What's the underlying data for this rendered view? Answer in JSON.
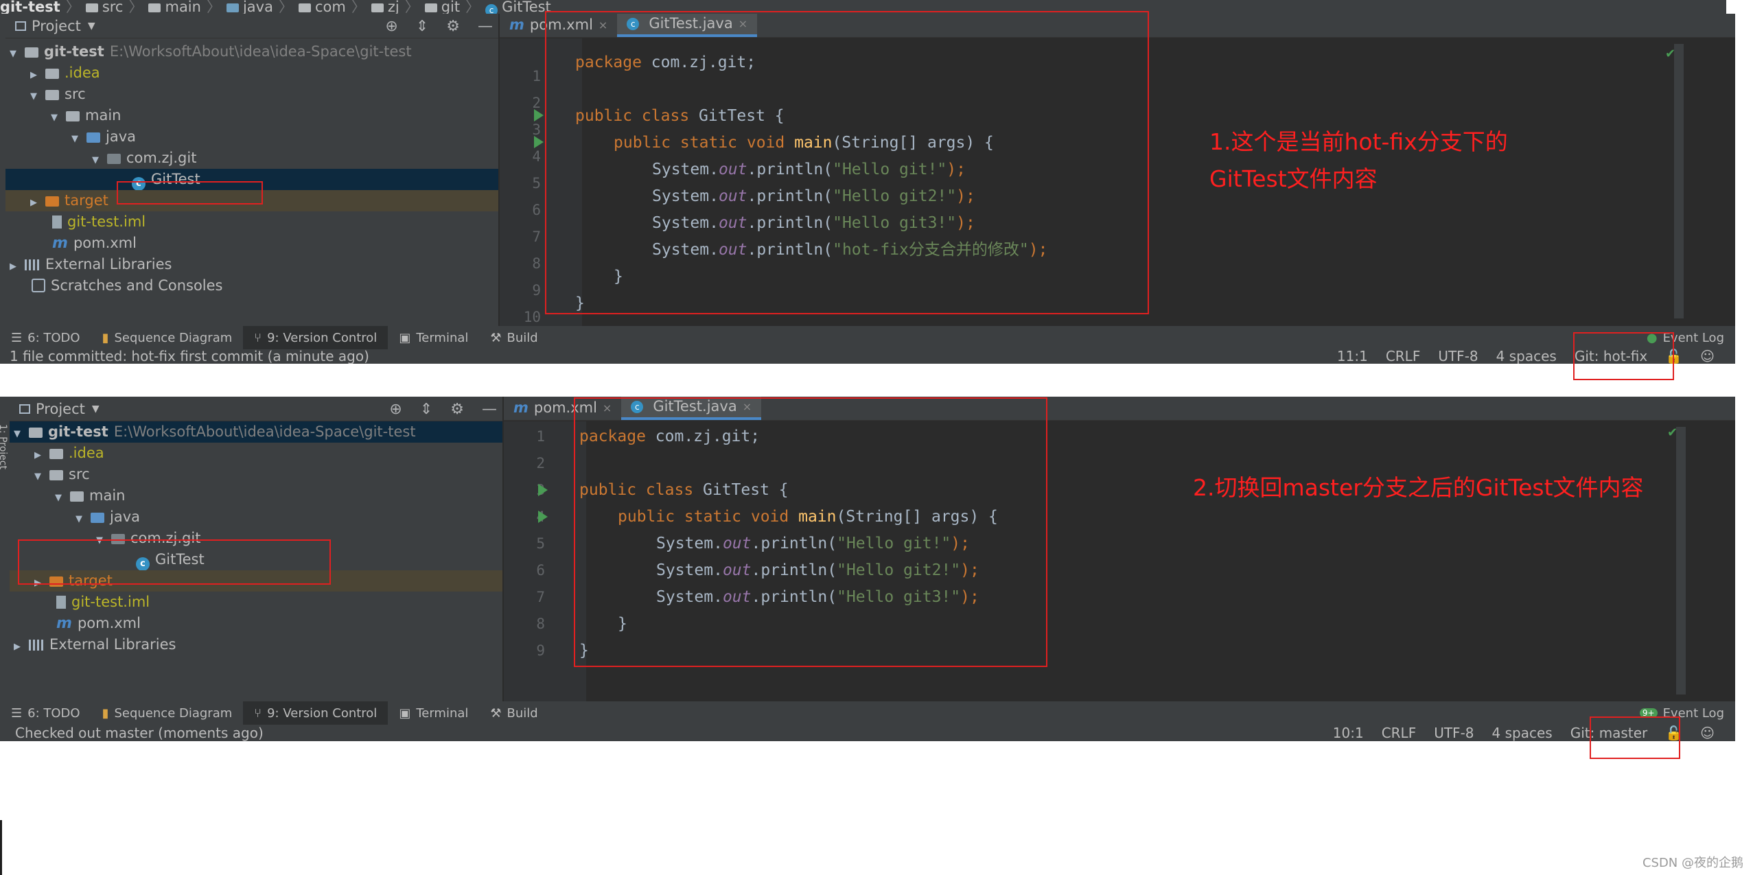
{
  "breadcrumb": [
    "git-test",
    "src",
    "main",
    "java",
    "com",
    "zj",
    "git",
    "GitTest"
  ],
  "panel1": {
    "project_label": "Project",
    "tree": [
      {
        "name": "git-test",
        "path": "E:\\WorksoftAbout\\idea\\idea-Space\\git-test"
      },
      {
        "name": ".idea"
      },
      {
        "name": "src"
      },
      {
        "name": "main"
      },
      {
        "name": "java"
      },
      {
        "name": "com.zj.git"
      },
      {
        "name": "GitTest"
      },
      {
        "name": "target"
      },
      {
        "name": "git-test.iml"
      },
      {
        "name": "pom.xml"
      },
      {
        "name": "External Libraries"
      },
      {
        "name": "Scratches and Consoles"
      }
    ],
    "tabs": [
      "pom.xml",
      "GitTest.java"
    ],
    "line_numbers": [
      "1",
      "2",
      "3",
      "4",
      "5",
      "6",
      "7",
      "8",
      "9",
      "10"
    ],
    "code": {
      "l1_kw": "package",
      "l1_rest": " com.zj.git;",
      "l3_kw": "public class",
      "l3_rest": " GitTest {",
      "l4_kw": "public static void",
      "l4_fn": "main",
      "l4_rest": "(String[] args) {",
      "out": "System.",
      "out_field": "out",
      "println": ".println(",
      "s1": "\"Hello git!\"",
      "s2": "\"Hello git2!\"",
      "s3": "\"Hello git3!\"",
      "s4": "\"hot-fix分支合并的修改\"",
      "end": ");",
      "close_inner": "}",
      "close_outer": "}"
    },
    "toolbar": [
      "6: TODO",
      "Sequence Diagram",
      "9: Version Control",
      "Terminal",
      "Build",
      "Event Log"
    ],
    "status_msg": "1 file committed: hot-fix first commit (a minute ago)",
    "status_right": [
      "11:1",
      "CRLF",
      "UTF-8",
      "4 spaces",
      "Git: hot-fix"
    ],
    "annotation": [
      "1.这个是当前hot-fix分支下的",
      "GitTest文件内容"
    ]
  },
  "panel2": {
    "project_label": "Project",
    "side_label": "1: Project",
    "tree": [
      {
        "name": "git-test",
        "path": "E:\\WorksoftAbout\\idea\\idea-Space\\git-test"
      },
      {
        "name": ".idea"
      },
      {
        "name": "src"
      },
      {
        "name": "main"
      },
      {
        "name": "java"
      },
      {
        "name": "com.zj.git"
      },
      {
        "name": "GitTest"
      },
      {
        "name": "target"
      },
      {
        "name": "git-test.iml"
      },
      {
        "name": "pom.xml"
      },
      {
        "name": "External Libraries"
      }
    ],
    "tabs": [
      "pom.xml",
      "GitTest.java"
    ],
    "line_numbers": [
      "1",
      "2",
      "3",
      "4",
      "5",
      "6",
      "7",
      "8",
      "9"
    ],
    "toolbar": [
      "6: TODO",
      "Sequence Diagram",
      "9: Version Control",
      "Terminal",
      "Build",
      "Event Log"
    ],
    "event_badge": "9+",
    "status_msg": "Checked out master (moments ago)",
    "status_right": [
      "10:1",
      "CRLF",
      "UTF-8",
      "4 spaces",
      "Git: master"
    ],
    "annotation": "2.切换回master分支之后的GitTest文件内容"
  },
  "watermark": "CSDN @夜的企鹅",
  "colors": {
    "keyword": "#cc7832",
    "string": "#6a8759",
    "field": "#9876aa",
    "function": "#ffc66d",
    "annotation": "#ff2020",
    "box": "#e02020"
  }
}
